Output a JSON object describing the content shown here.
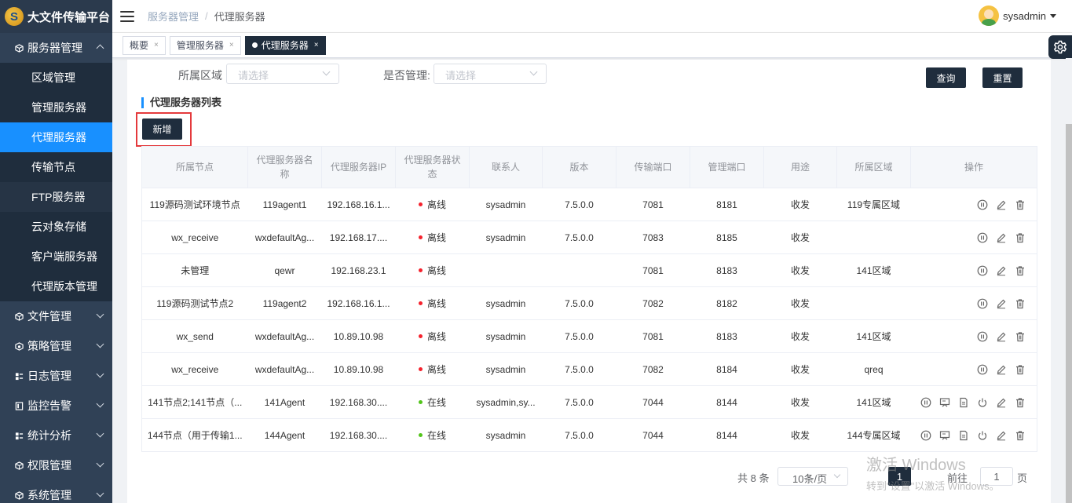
{
  "app": {
    "title": "大文件传输平台",
    "logo_glyph": "S"
  },
  "sidebar": {
    "groups": [
      {
        "label": "服务器管理",
        "icon": "cube-icon",
        "expanded": true
      },
      {
        "label": "文件管理",
        "icon": "cube-icon"
      },
      {
        "label": "策略管理",
        "icon": "policy-icon"
      },
      {
        "label": "日志管理",
        "icon": "log-icon"
      },
      {
        "label": "监控告警",
        "icon": "monitor-icon"
      },
      {
        "label": "统计分析",
        "icon": "stats-icon"
      },
      {
        "label": "权限管理",
        "icon": "cube-icon"
      },
      {
        "label": "系统管理",
        "icon": "cube-icon"
      }
    ],
    "sub_items": [
      "区域管理",
      "管理服务器",
      "代理服务器",
      "传输节点",
      "FTP服务器",
      "云对象存储",
      "客户端服务器",
      "代理版本管理"
    ],
    "active_sub": "代理服务器"
  },
  "header": {
    "breadcrumb": [
      "服务器管理",
      "代理服务器"
    ],
    "separator": "/",
    "username": "sysadmin"
  },
  "tags": [
    {
      "label": "概要",
      "close": "×"
    },
    {
      "label": "管理服务器",
      "close": "×"
    },
    {
      "label": "代理服务器",
      "close": "×",
      "active": true
    }
  ],
  "filter": {
    "region_label": "所属区域",
    "region_placeholder": "请选择",
    "managed_label": "是否管理:",
    "managed_placeholder": "请选择",
    "query_label": "查询",
    "reset_label": "重置"
  },
  "list": {
    "title": "代理服务器列表",
    "add_label": "新增"
  },
  "table": {
    "columns": [
      "所属节点",
      "代理服务器名称",
      "代理服务器IP",
      "代理服务器状态",
      "联系人",
      "版本",
      "传输端口",
      "管理端口",
      "用途",
      "所属区域",
      "操作"
    ],
    "rows": [
      {
        "node": "119源码测试环境节点",
        "name": "119agent1",
        "ip": "192.168.16.1...",
        "status": "离线",
        "contact": "sysadmin",
        "version": "7.5.0.0",
        "transfer_port": "7081",
        "mgmt_port": "8181",
        "usage": "收发",
        "region": "119专属区域",
        "online": false
      },
      {
        "node": "wx_receive",
        "name": "wxdefaultAg...",
        "ip": "192.168.17....",
        "status": "离线",
        "contact": "sysadmin",
        "version": "7.5.0.0",
        "transfer_port": "7083",
        "mgmt_port": "8185",
        "usage": "收发",
        "region": "",
        "online": false
      },
      {
        "node": "未管理",
        "name": "qewr",
        "ip": "192.168.23.1",
        "status": "离线",
        "contact": "",
        "version": "",
        "transfer_port": "7081",
        "mgmt_port": "8183",
        "usage": "收发",
        "region": "141区域",
        "online": false
      },
      {
        "node": "119源码测试节点2",
        "name": "119agent2",
        "ip": "192.168.16.1...",
        "status": "离线",
        "contact": "sysadmin",
        "version": "7.5.0.0",
        "transfer_port": "7082",
        "mgmt_port": "8182",
        "usage": "收发",
        "region": "",
        "online": false
      },
      {
        "node": "wx_send",
        "name": "wxdefaultAg...",
        "ip": "10.89.10.98",
        "status": "离线",
        "contact": "sysadmin",
        "version": "7.5.0.0",
        "transfer_port": "7081",
        "mgmt_port": "8183",
        "usage": "收发",
        "region": "141区域",
        "online": false
      },
      {
        "node": "wx_receive",
        "name": "wxdefaultAg...",
        "ip": "10.89.10.98",
        "status": "离线",
        "contact": "sysadmin",
        "version": "7.5.0.0",
        "transfer_port": "7082",
        "mgmt_port": "8184",
        "usage": "收发",
        "region": "qreq",
        "online": false
      },
      {
        "node": "141节点2;141节点（...",
        "name": "141Agent",
        "ip": "192.168.30....",
        "status": "在线",
        "contact": "sysadmin,sy...",
        "version": "7.5.0.0",
        "transfer_port": "7044",
        "mgmt_port": "8144",
        "usage": "收发",
        "region": "141区域",
        "online": true
      },
      {
        "node": "144节点（用于传输1...",
        "name": "144Agent",
        "ip": "192.168.30....",
        "status": "在线",
        "contact": "sysadmin",
        "version": "7.5.0.0",
        "transfer_port": "7044",
        "mgmt_port": "8144",
        "usage": "收发",
        "region": "144专属区域",
        "online": true
      }
    ]
  },
  "pagination": {
    "total": "共 8 条",
    "page_size": "10条/页",
    "current_page": "1",
    "goto_label": "前往",
    "goto_value": "1",
    "page_unit": "页"
  },
  "watermark": {
    "line1": "激活 Windows",
    "line2": "转到\"设置\"以激活 Windows。"
  },
  "colors": {
    "sidebar_bg": "#304156",
    "submenu_bg": "#1f2d3d",
    "active": "#1890ff",
    "offline": "#f5222d",
    "online": "#52c41a",
    "dark_btn": "#1f2d3d",
    "highlight_border": "#e4393c"
  }
}
